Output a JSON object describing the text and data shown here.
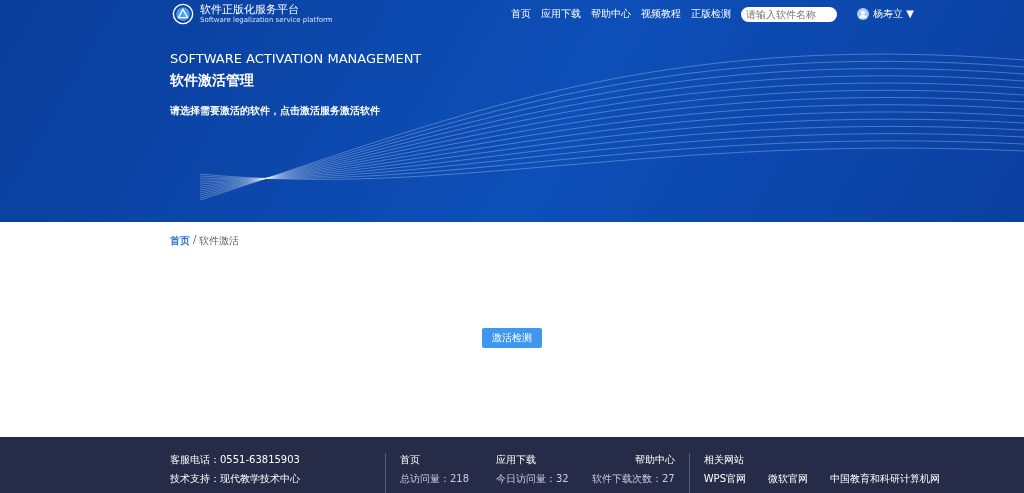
{
  "header": {
    "logo_title": "软件正版化服务平台",
    "logo_subtitle": "Software legalization service platform",
    "nav": [
      {
        "label": "首页",
        "selected": false
      },
      {
        "label": "应用下载",
        "selected": false
      },
      {
        "label": "帮助中心",
        "selected": false
      },
      {
        "label": "视频教程",
        "selected": false
      },
      {
        "label": "正版检测",
        "selected": false
      }
    ],
    "search": {
      "placeholder": "请输入软件名称"
    },
    "user": {
      "name": "杨寿立",
      "caret": "▼"
    }
  },
  "banner": {
    "title_en": "SOFTWARE ACTIVATION MANAGEMENT",
    "title": "软件激活管理",
    "subtitle": "请选择需要激活的软件，点击激活服务激活软件"
  },
  "breadcrumb": {
    "home": "首页",
    "separator": "/",
    "current": "软件激活"
  },
  "action_button": "激活检测",
  "footer": {
    "contact": [
      "客服电话：0551-63815903",
      "技术支持：现代教学技术中心"
    ],
    "links": [
      {
        "title": "首页",
        "stat": "总访问量：218"
      },
      {
        "title": "应用下载",
        "stat": "今日访问量：32"
      },
      {
        "title": "帮助中心",
        "stat": "软件下载次数：27"
      }
    ],
    "related": {
      "title": "相关网站",
      "sites": [
        "WPS官网",
        "微软官网",
        "中国教育和科研计算机网"
      ]
    }
  }
}
